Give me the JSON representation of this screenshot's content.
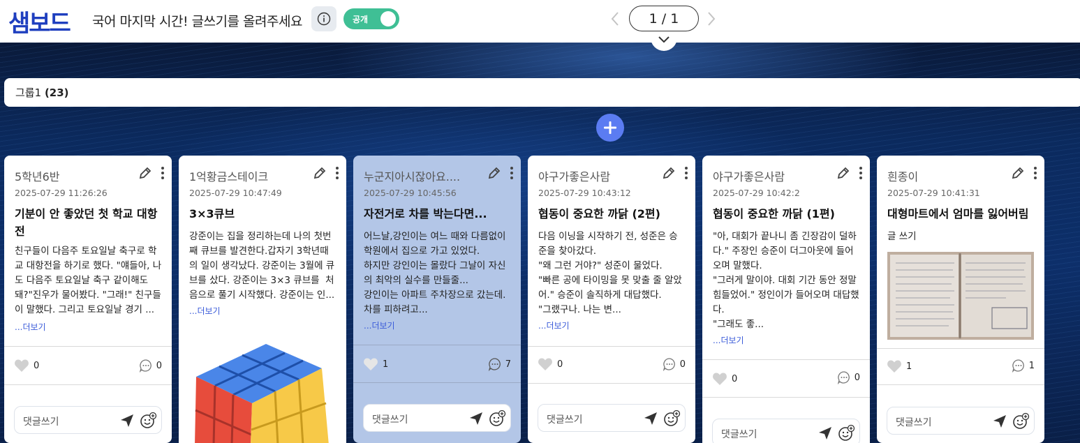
{
  "header": {
    "logo": "샘보드",
    "board_title": "국어 마지막 시간! 글쓰기를 올려주세요",
    "public_label": "공개",
    "pager": "1 / 1"
  },
  "group": {
    "name": "그룹1",
    "count": "(23)"
  },
  "comment_placeholder": "댓글쓰기",
  "more_label": "...더보기",
  "cards": [
    {
      "author": "5학년6반",
      "date": "2025-07-29 11:26:26",
      "title": "기분이 안 좋았던 첫 학교 대항전",
      "body": "친구들이 다음주 토요일날 축구로 학교 대항전을 하기로 했다. \"얘들아, 나도 다음주 토요일날 축구 같이해도 돼?\"진우가 물어봤다. \"그래!\" 친구들이 말했다. 그리고 토요일날 경기 ...",
      "likes": "0",
      "comments": "0"
    },
    {
      "author": "1억황금스테이크",
      "date": "2025-07-29 10:47:49",
      "title": "3×3큐브",
      "body": "강준이는 집을 정리하는데 나의 첫번째 큐브를 발견한다.갑자기 3학년때의 일이 생각났다. 강준이는 3월에 큐브를 샀다. 강준이는 3×3 큐브를  처음으로 풀기 시작했다. 강준이는 인...",
      "likes": "",
      "comments": ""
    },
    {
      "author": "누군지아시잖아요....",
      "date": "2025-07-29 10:45:56",
      "title": "자전거로 차를 박는다면...",
      "body": "어느날,강인이는 여느 때와 다름없이 학원에서 집으로 가고 있었다.\n하지만 강인이는 몰랐다 그날이 자신의 최악의 실수를 만들줄...\n강인이는 아파트 주차장으로 갔는데. 차를 피하려고...",
      "likes": "1",
      "comments": "7"
    },
    {
      "author": "야구가좋은사람",
      "date": "2025-07-29 10:43:12",
      "title": "협동이 중요한 까닭 (2편)",
      "body": "다음 이닝을 시작하기 전, 성준은 승준을 찾아갔다.\n\"왜 그런 거야?\" 성준이 물었다.\n\"빠른 공에 타이밍을 못 맞출 줄 알았어.\" 승준이 솔직하게 대답했다.\n\"그랬구나. 나는 변...",
      "likes": "0",
      "comments": "0"
    },
    {
      "author": "야구가좋은사람",
      "date": "2025-07-29 10:42:2",
      "title": "협동이 중요한 까닭 (1편)",
      "body": "\"아, 대회가 끝나니 좀 긴장감이 덜하다.\" 주장인 승준이 더그아웃에 들어오며 말했다.\n\"그러게 말이야. 대회 기간 동안 정말 힘들었어.\" 정인이가 들어오며 대답했다.\n\"그래도 좋...",
      "likes": "0",
      "comments": "0"
    },
    {
      "author": "흰종이",
      "date": "2025-07-29 10:41:31",
      "title": "대형마트에서 엄마를 잃어버림",
      "body": "글 쓰기",
      "likes": "1",
      "comments": "1"
    }
  ]
}
